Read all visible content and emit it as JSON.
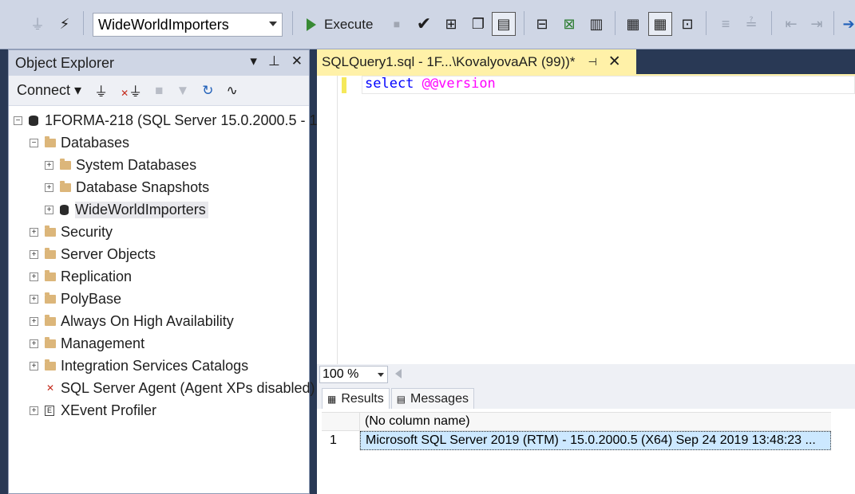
{
  "toolbar": {
    "database": "WideWorldImporters",
    "execute_label": "Execute",
    "icons": [
      "plug-icon",
      "connect-icon",
      "database-selector",
      "play-icon",
      "stop-icon",
      "check-icon",
      "parse-icon",
      "display-plan-icon",
      "query-designer-icon",
      "results-text-icon",
      "results-grid-icon",
      "results-file-icon",
      "comment-icon",
      "uncomment-icon",
      "outdent-icon",
      "indent-icon"
    ]
  },
  "object_explorer": {
    "title": "Object Explorer",
    "pin_glyph": "▾",
    "dock_glyph": "⊥",
    "close_glyph": "✕",
    "connect_label": "Connect",
    "tree": {
      "server": "1FORMA-218 (SQL Server 15.0.2000.5 - 1",
      "databases": "Databases",
      "system_databases": "System Databases",
      "database_snapshots": "Database Snapshots",
      "wwi": "WideWorldImporters",
      "security": "Security",
      "server_objects": "Server Objects",
      "replication": "Replication",
      "polybase": "PolyBase",
      "always_on": "Always On High Availability",
      "management": "Management",
      "integration_services": "Integration Services Catalogs",
      "sql_agent": "SQL Server Agent (Agent XPs disabled)",
      "xevent": "XEvent Profiler"
    }
  },
  "document_tab": {
    "title": "SQLQuery1.sql - 1F...\\KovalyovaAR (99))*"
  },
  "editor": {
    "keyword": "select",
    "function": "@@version"
  },
  "zoom": {
    "value": "100 %"
  },
  "results": {
    "tab_results": "Results",
    "tab_messages": "Messages",
    "column_header": "(No column name)",
    "row_number": "1",
    "value": "Microsoft SQL Server 2019 (RTM) - 15.0.2000.5 (X64)   Sep 24 2019 13:48:23   ..."
  },
  "colors": {
    "active_tab": "#fff1a8",
    "selection": "#cce8ff",
    "keyword": "#0000ff",
    "function": "#ff00ff"
  }
}
